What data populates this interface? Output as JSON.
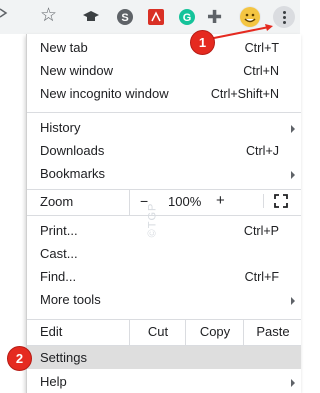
{
  "toolbar": {
    "icons": [
      "star-icon",
      "graduation-cap-icon",
      "skype-icon",
      "pdf-icon",
      "grammarly-icon",
      "puzzle-icon",
      "avatar-icon",
      "more-menu-icon"
    ]
  },
  "menu": {
    "new_tab": {
      "label": "New tab",
      "shortcut": "Ctrl+T"
    },
    "new_window": {
      "label": "New window",
      "shortcut": "Ctrl+N"
    },
    "new_incognito": {
      "label": "New incognito window",
      "shortcut": "Ctrl+Shift+N"
    },
    "history": {
      "label": "History"
    },
    "downloads": {
      "label": "Downloads",
      "shortcut": "Ctrl+J"
    },
    "bookmarks": {
      "label": "Bookmarks"
    },
    "zoom": {
      "label": "Zoom",
      "minus": "−",
      "value": "100%",
      "plus": "+"
    },
    "print": {
      "label": "Print...",
      "shortcut": "Ctrl+P"
    },
    "cast": {
      "label": "Cast..."
    },
    "find": {
      "label": "Find...",
      "shortcut": "Ctrl+F"
    },
    "more_tools": {
      "label": "More tools"
    },
    "edit": {
      "label": "Edit",
      "cut": "Cut",
      "copy": "Copy",
      "paste": "Paste"
    },
    "settings": {
      "label": "Settings"
    },
    "help": {
      "label": "Help"
    }
  },
  "annotations": {
    "step1": "1",
    "step2": "2",
    "watermark": "©TGP"
  },
  "colors": {
    "badge": "#e52a20",
    "highlight": "#dedede",
    "toolbar": "#f1f3f4"
  }
}
